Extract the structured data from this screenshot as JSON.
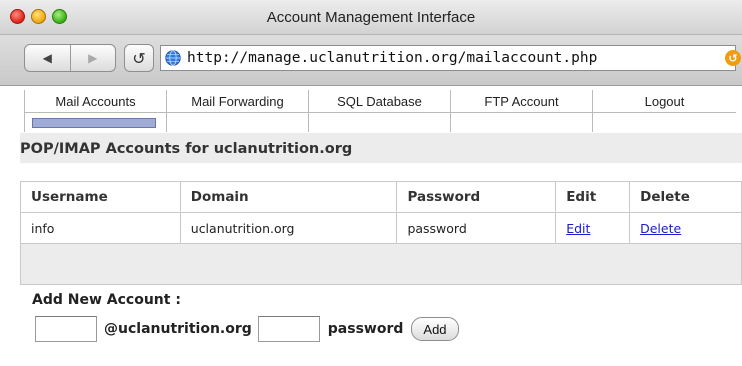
{
  "window": {
    "title": "Account Management Interface"
  },
  "browser": {
    "url": "http://manage.uclanutrition.org/mailaccount.php",
    "back_glyph": "◀",
    "forward_glyph": "▶",
    "reload_glyph": "↺",
    "feed_glyph": "↺",
    "icons": [
      "back-arrow-icon",
      "forward-arrow-icon",
      "reload-icon",
      "globe-icon",
      "rss-icon"
    ]
  },
  "nav": {
    "tabs": [
      "Mail Accounts",
      "Mail Forwarding",
      "SQL Database",
      "FTP Account",
      "Logout"
    ],
    "active_color": "#a0acd6"
  },
  "page": {
    "heading": "POP/IMAP Accounts for uclanutrition.org"
  },
  "table": {
    "headers": [
      "Username",
      "Domain",
      "Password",
      "Edit",
      "Delete"
    ],
    "rows": [
      {
        "username": "info",
        "domain": "uclanutrition.org",
        "password": "password",
        "edit": "Edit",
        "delete": "Delete"
      }
    ],
    "link_color": "#1a1ad0"
  },
  "add_form": {
    "title": "Add New Account :",
    "username_value": "",
    "domain_suffix": "@uclanutrition.org",
    "password_value": "",
    "password_label": "password",
    "button": "Add"
  }
}
